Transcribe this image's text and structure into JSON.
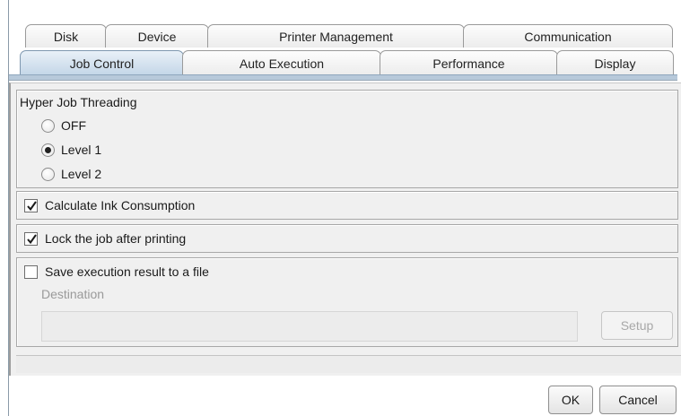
{
  "tabs": {
    "row1": [
      {
        "label": "Disk"
      },
      {
        "label": "Device"
      },
      {
        "label": "Printer Management"
      },
      {
        "label": "Communication"
      }
    ],
    "row2": [
      {
        "label": "Job Control",
        "selected": true
      },
      {
        "label": "Auto Execution"
      },
      {
        "label": "Performance"
      },
      {
        "label": "Display"
      }
    ]
  },
  "hyper_job": {
    "title": "Hyper Job Threading",
    "options": [
      {
        "label": "OFF",
        "selected": false
      },
      {
        "label": "Level 1",
        "selected": true
      },
      {
        "label": "Level 2",
        "selected": false
      }
    ]
  },
  "ink": {
    "label": "Calculate Ink Consumption",
    "checked": true
  },
  "lock": {
    "label": "Lock the job after printing",
    "checked": true
  },
  "save_result": {
    "label": "Save execution result to a file",
    "checked": false,
    "destination_label": "Destination",
    "destination_value": "",
    "setup_label": "Setup"
  },
  "footer": {
    "ok_label": "OK",
    "cancel_label": "Cancel"
  },
  "colors": {
    "selected_tab": "#c3d6e7",
    "panel": "#f0f0f0",
    "disabled_text": "#9a9a9a"
  },
  "icons": {
    "check": "check-icon",
    "radio_dot": "radio-dot-icon"
  }
}
